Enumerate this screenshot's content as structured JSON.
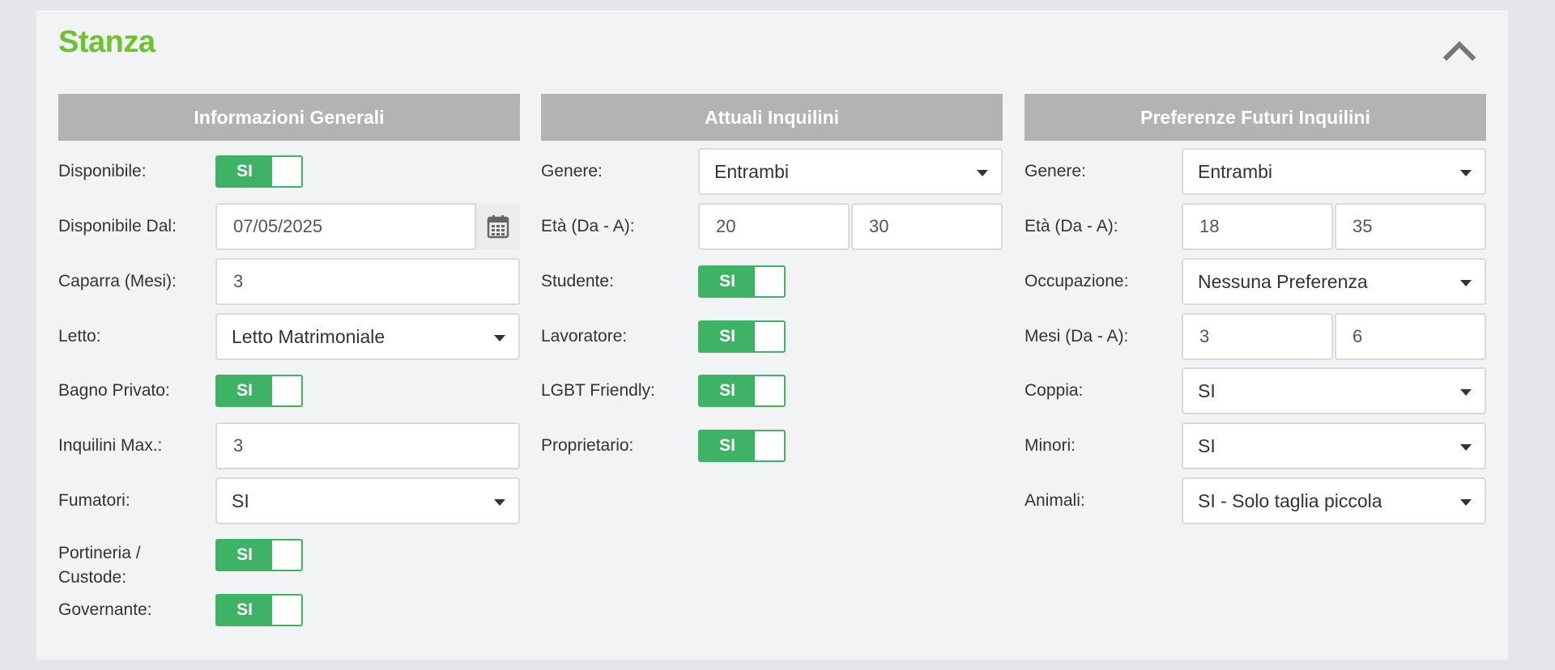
{
  "panel": {
    "title": "Stanza"
  },
  "general": {
    "header": "Informazioni Generali",
    "disponibile": {
      "label": "Disponibile:",
      "value": "SI"
    },
    "disponibile_dal": {
      "label": "Disponibile Dal:",
      "value": "07/05/2025"
    },
    "caparra": {
      "label": "Caparra (Mesi):",
      "value": "3"
    },
    "letto": {
      "label": "Letto:",
      "value": "Letto Matrimoniale"
    },
    "bagno": {
      "label": "Bagno Privato:",
      "value": "SI"
    },
    "inquilini_max": {
      "label": "Inquilini Max.:",
      "value": "3"
    },
    "fumatori": {
      "label": "Fumatori:",
      "value": "SI"
    },
    "portineria": {
      "label_line1": "Portineria /",
      "label_line2": "Custode:",
      "value": "SI"
    },
    "governante": {
      "label": "Governante:",
      "value": "SI"
    }
  },
  "current": {
    "header": "Attuali Inquilini",
    "genere": {
      "label": "Genere:",
      "value": "Entrambi"
    },
    "eta": {
      "label": "Età (Da - A):",
      "from": "20",
      "to": "30"
    },
    "studente": {
      "label": "Studente:",
      "value": "SI"
    },
    "lavoratore": {
      "label": "Lavoratore:",
      "value": "SI"
    },
    "lgbt": {
      "label": "LGBT Friendly:",
      "value": "SI"
    },
    "proprietario": {
      "label": "Proprietario:",
      "value": "SI"
    }
  },
  "future": {
    "header": "Preferenze Futuri Inquilini",
    "genere": {
      "label": "Genere:",
      "value": "Entrambi"
    },
    "eta": {
      "label": "Età (Da - A):",
      "from": "18",
      "to": "35"
    },
    "occupazione": {
      "label": "Occupazione:",
      "value": "Nessuna Preferenza"
    },
    "mesi": {
      "label": "Mesi (Da - A):",
      "from": "3",
      "to": "6"
    },
    "coppia": {
      "label": "Coppia:",
      "value": "SI"
    },
    "minori": {
      "label": "Minori:",
      "value": "SI"
    },
    "animali": {
      "label": "Animali:",
      "value": "SI - Solo taglia piccola"
    }
  },
  "icons": {
    "collapse": "chevron-up-icon",
    "calendar": "calendar-icon"
  },
  "colors": {
    "title": "#6cc230",
    "toggle_on": "#3fb365",
    "header_bg": "#b3b3b3"
  }
}
